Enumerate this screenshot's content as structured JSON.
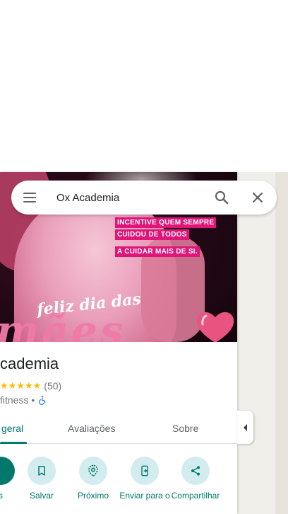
{
  "search": {
    "value": "Ox Academia"
  },
  "hero": {
    "promo_lines": [
      "INCENTIVE QUEM SEMPRE",
      "CUIDOU DE TODOS",
      "A CUIDAR MAIS DE SI."
    ],
    "script_text": "feliz dia das",
    "big_text": "mães"
  },
  "place": {
    "name": "cademia",
    "rating_stars": "★★★★★",
    "review_count": "(50)",
    "category": "fitness •"
  },
  "tabs": [
    {
      "label": "geral",
      "active": true
    },
    {
      "label": "Avaliações",
      "active": false
    },
    {
      "label": "Sobre",
      "active": false
    }
  ],
  "actions": [
    {
      "label": "s",
      "icon": "directions-icon"
    },
    {
      "label": "Salvar",
      "icon": "bookmark-icon"
    },
    {
      "label": "Próximo",
      "icon": "nearby-icon"
    },
    {
      "label": "Enviar para o",
      "icon": "send-to-phone-icon"
    },
    {
      "label": "Compartilhar",
      "icon": "share-icon"
    }
  ],
  "colors": {
    "accent": "#00796b",
    "action_bg": "#d2ecef",
    "star": "#fbbc04",
    "promo_bg": "#e0157a"
  }
}
